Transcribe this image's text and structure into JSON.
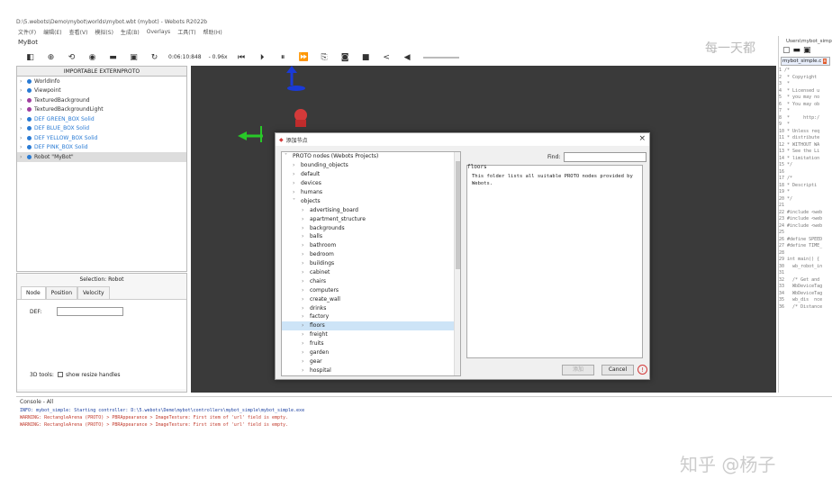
{
  "window": {
    "title": "D:\\5.webots\\Demo\\mybot\\worlds\\mybot.wbt (mybot) - Webots R2022b",
    "menus": [
      "文件(F)",
      "编辑(E)",
      "查看(V)",
      "模拟(S)",
      "生成(B)",
      "Overlays",
      "工具(T)",
      "帮助(H)"
    ],
    "world_name": "MyBot"
  },
  "toolbar": {
    "time": "0:06:10:848",
    "speed": "- 0.96x"
  },
  "scene_tree": {
    "header": "IMPORTABLE EXTERNPROTO",
    "items": [
      {
        "label": "WorldInfo",
        "color": "#2a7bd4"
      },
      {
        "label": "Viewpoint",
        "color": "#2a7bd4"
      },
      {
        "label": "TexturedBackground",
        "color": "#a040a0"
      },
      {
        "label": "TexturedBackgroundLight",
        "color": "#a040a0"
      },
      {
        "label": "DEF GREEN_BOX Solid",
        "color": "#2a7bd4"
      },
      {
        "label": "DEF BLUE_BOX Solid",
        "color": "#2a7bd4"
      },
      {
        "label": "DEF YELLOW_BOX Solid",
        "color": "#2a7bd4"
      },
      {
        "label": "DEF PINK_BOX Solid",
        "color": "#2a7bd4"
      },
      {
        "label": "Robot \"MyBot\"",
        "color": "#2a7bd4"
      }
    ]
  },
  "field_editor": {
    "selection": "Selection: Robot",
    "tabs": [
      "Node",
      "Position",
      "Velocity"
    ],
    "def_label": "DEF:",
    "tools_label": "3D tools:",
    "tools_option": "show resize handles"
  },
  "dialog": {
    "title": "添加节点",
    "root": "PROTO nodes (Webots Projects)",
    "find_label": "Find:",
    "selected_name": "floors",
    "description": "This folder lists all suitable PROTO nodes provided by Webots.",
    "add_label": "添加",
    "cancel_label": "Cancel",
    "level1": [
      "bounding_objects",
      "default",
      "devices",
      "humans",
      "objects"
    ],
    "objects_children": [
      "advertising_board",
      "apartment_structure",
      "backgrounds",
      "balls",
      "bathroom",
      "bedroom",
      "buildings",
      "cabinet",
      "chairs",
      "computers",
      "create_wall",
      "drinks",
      "factory",
      "floors",
      "freight",
      "fruits",
      "garden",
      "gear",
      "hospital"
    ]
  },
  "editor": {
    "path": "Users\\mybot_simp",
    "tab": "mybot_simple.c",
    "lines": [
      "1 /*",
      "2  * Copyright",
      "3  *",
      "4  * Licensed u",
      "5  * you may no",
      "6  * You may ob",
      "7  *",
      "8  *     http:/",
      "9  *",
      "10 * Unless req",
      "11 * distribute",
      "12 * WITHOUT WA",
      "13 * See the Li",
      "14 * limitation",
      "15 */",
      "16",
      "17 /*",
      "18 * Descripti",
      "19 *",
      "20 */",
      "21",
      "22 #include <web",
      "23 #include <web",
      "24 #include <web",
      "25",
      "26 #define SPEED",
      "27 #define TIME_",
      "28",
      "29 int main() {",
      "30   wb_robot_in",
      "31",
      "32   /* Get and",
      "33   WbDeviceTag",
      "34   WbDeviceTag",
      "35   wb_dis  nce",
      "36   /* Distance"
    ]
  },
  "console": {
    "title": "Console - All",
    "lines": [
      {
        "text": "INFO: mybot_simple: Starting controller: D:\\5.webots\\Demo\\mybot\\controllers\\mybot_simple\\mybot_simple.exe",
        "color": "#1a3fa0"
      },
      {
        "text": "WARNING: RectangleArena (PROTO) > PBRAppearance > ImageTexture: First item of 'url' field is empty.",
        "color": "#c0392b"
      },
      {
        "text": "WARNING: RectangleArena (PROTO) > PBRAppearance > ImageTexture: First item of 'url' field is empty.",
        "color": "#c0392b"
      }
    ]
  },
  "watermark": "知乎 @杨子",
  "watermark_top": "每一天都"
}
